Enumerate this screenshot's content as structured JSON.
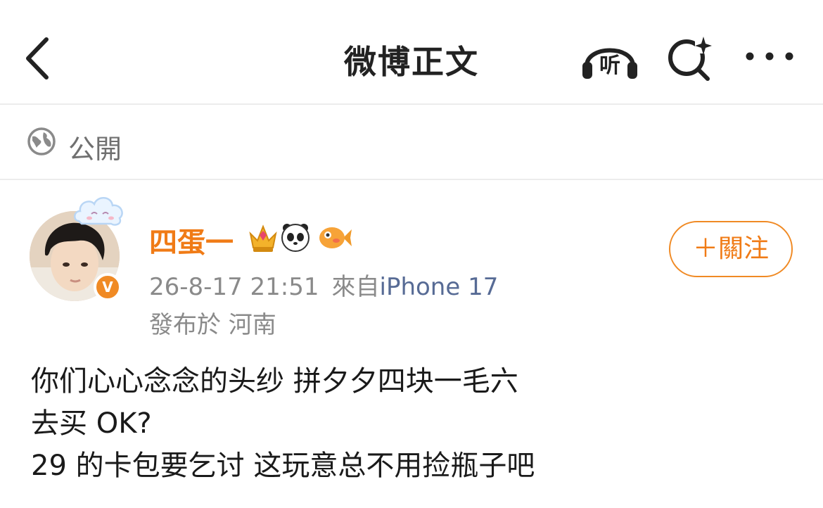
{
  "nav": {
    "title": "微博正文",
    "back_icon": "chevron-left-icon",
    "listen_label": "听",
    "search_icon": "search-sparkle-icon",
    "more_icon": "more-horizontal-icon"
  },
  "visibility": {
    "icon": "globe-icon",
    "label": "公開"
  },
  "post": {
    "author": {
      "name": "四蛋一",
      "verified_badge": "V",
      "badges": [
        "crown-icon",
        "panda-icon",
        "goldfish-icon"
      ]
    },
    "timestamp": "26-8-17 21:51",
    "source_prefix": "來自",
    "device": "iPhone 17",
    "location": "發布於 河南",
    "follow_label": "＋關注",
    "content_lines": [
      "你们心心念念的头纱 拼夕夕四块一毛六",
      "去买 OK?",
      "29 的卡包要乞讨 这玩意总不用捡瓶子吧"
    ]
  },
  "colors": {
    "accent": "#f07b16",
    "link": "#576b95",
    "meta": "#8a8a8a"
  }
}
